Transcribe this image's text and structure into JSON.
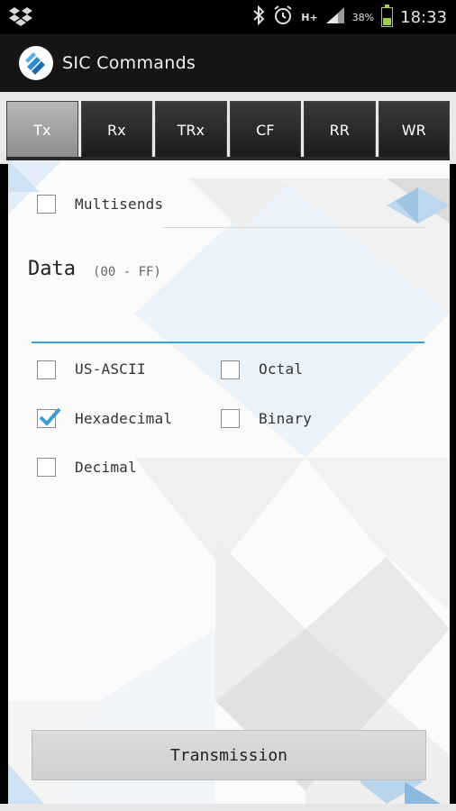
{
  "status_bar": {
    "time": "18:33",
    "battery_percent": "38%",
    "battery_level": 0.38,
    "network": "H+",
    "icons": [
      "dropbox-icon",
      "bluetooth-icon",
      "alarm-icon",
      "signal-icon",
      "battery-icon"
    ]
  },
  "app": {
    "title": "SIC Commands"
  },
  "tabs": [
    {
      "label": "Tx",
      "active": true
    },
    {
      "label": "Rx",
      "active": false
    },
    {
      "label": "TRx",
      "active": false
    },
    {
      "label": "CF",
      "active": false
    },
    {
      "label": "RR",
      "active": false
    },
    {
      "label": "WR",
      "active": false
    }
  ],
  "multisends": {
    "label": "Multisends",
    "checked": false,
    "value": ""
  },
  "data": {
    "title": "Data",
    "range": "(00 - FF)",
    "value": ""
  },
  "formats": {
    "us_ascii": {
      "label": "US-ASCII",
      "checked": false
    },
    "octal": {
      "label": "Octal",
      "checked": false
    },
    "hexadecimal": {
      "label": "Hexadecimal",
      "checked": true
    },
    "binary": {
      "label": "Binary",
      "checked": false
    },
    "decimal": {
      "label": "Decimal",
      "checked": false
    }
  },
  "actions": {
    "transmission_label": "Transmission"
  },
  "colors": {
    "accent": "#3c9ed8",
    "tab_active": "#9e9e9e",
    "tab_inactive": "#262626"
  }
}
